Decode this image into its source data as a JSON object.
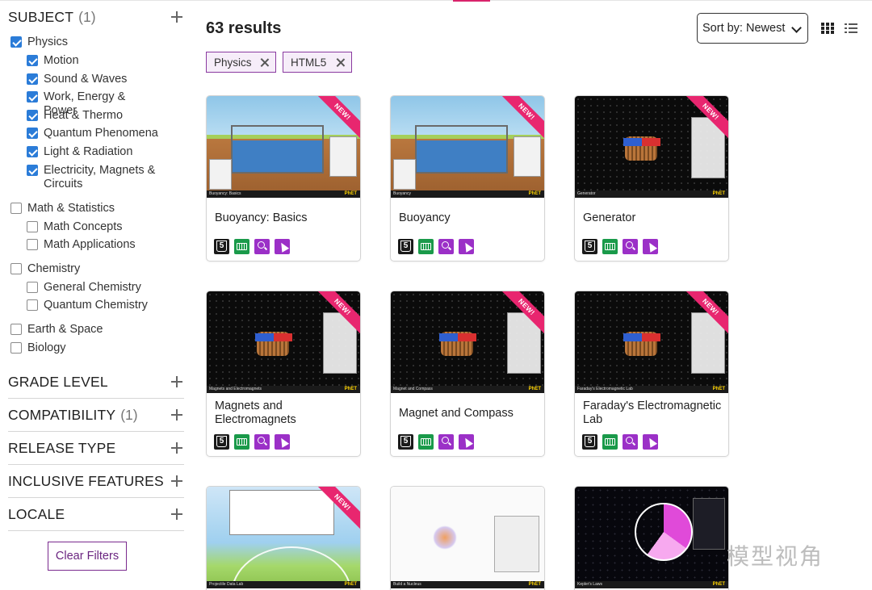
{
  "sidebar": {
    "subject": {
      "title": "SUBJECT",
      "count": "(1)",
      "items": [
        {
          "label": "Physics",
          "checked": true,
          "level": 0
        },
        {
          "label": "Motion",
          "checked": true,
          "level": 1
        },
        {
          "label": "Sound & Waves",
          "checked": true,
          "level": 1
        },
        {
          "label": "Work, Energy & Power",
          "checked": true,
          "level": 1
        },
        {
          "label": "Heat & Thermo",
          "checked": true,
          "level": 1
        },
        {
          "label": "Quantum Phenomena",
          "checked": true,
          "level": 1
        },
        {
          "label": "Light & Radiation",
          "checked": true,
          "level": 1
        },
        {
          "label": "Electricity, Magnets & Circuits",
          "checked": true,
          "level": 1
        },
        {
          "label": "Math & Statistics",
          "checked": false,
          "level": 0
        },
        {
          "label": "Math Concepts",
          "checked": false,
          "level": 1
        },
        {
          "label": "Math Applications",
          "checked": false,
          "level": 1
        },
        {
          "label": "Chemistry",
          "checked": false,
          "level": 0
        },
        {
          "label": "General Chemistry",
          "checked": false,
          "level": 1
        },
        {
          "label": "Quantum Chemistry",
          "checked": false,
          "level": 1
        },
        {
          "label": "Earth & Space",
          "checked": false,
          "level": 0
        },
        {
          "label": "Biology",
          "checked": false,
          "level": 0
        }
      ]
    },
    "sections": [
      {
        "title": "GRADE LEVEL",
        "count": ""
      },
      {
        "title": "COMPATIBILITY",
        "count": "(1)"
      },
      {
        "title": "RELEASE TYPE",
        "count": ""
      },
      {
        "title": "INCLUSIVE FEATURES",
        "count": ""
      },
      {
        "title": "LOCALE",
        "count": ""
      }
    ],
    "clear_label": "Clear Filters"
  },
  "main": {
    "results": "63 results",
    "sort_label": "Sort by: Newest",
    "chips": [
      "Physics",
      "HTML5"
    ],
    "new_label": "NEW!",
    "brand": "PhET",
    "cards": [
      {
        "title": "Buoyancy: Basics",
        "bar_title": "Buoyancy: Basics",
        "is_new": true,
        "scene": "water"
      },
      {
        "title": "Buoyancy",
        "bar_title": "Buoyancy",
        "is_new": true,
        "scene": "water"
      },
      {
        "title": "Generator",
        "bar_title": "Generator",
        "is_new": true,
        "scene": "dark"
      },
      {
        "title": "Magnets and Electromagnets",
        "bar_title": "Magnets and Electromagnets",
        "is_new": true,
        "scene": "dark"
      },
      {
        "title": "Magnet and Compass",
        "bar_title": "Magnet and Compass",
        "is_new": true,
        "scene": "dark"
      },
      {
        "title": "Faraday's Electromagnetic Lab",
        "bar_title": "Faraday's Electromagnetic Lab",
        "is_new": true,
        "scene": "dark"
      },
      {
        "title": "",
        "bar_title": "Projectile Data Lab",
        "is_new": true,
        "scene": "projectile"
      },
      {
        "title": "",
        "bar_title": "Build a Nucleus",
        "is_new": false,
        "scene": "white"
      },
      {
        "title": "",
        "bar_title": "Kepler's Laws",
        "is_new": false,
        "scene": "space"
      }
    ]
  },
  "watermark": "模型视角",
  "colors": {
    "accent_purple": "#8a3aa0",
    "checkbox_blue": "#2b7cd8",
    "new_ribbon": "#e8266f"
  }
}
